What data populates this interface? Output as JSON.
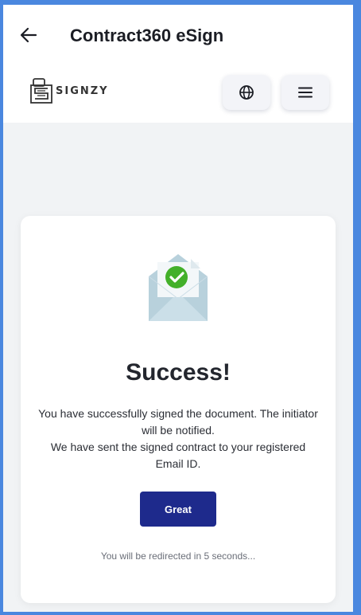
{
  "appbar": {
    "title": "Contract360 eSign"
  },
  "brand": {
    "logo_text": "SIGNZY"
  },
  "success": {
    "heading": "Success!",
    "line1": "You have successfully signed the document. The initiator will be notified.",
    "line2": "We have sent the signed contract to your registered Email ID.",
    "button_label": "Great",
    "redirect_text": "You will be redirected in 5 seconds..."
  },
  "icons": {
    "back": "arrow-left-icon",
    "language": "globe-icon",
    "menu": "hamburger-menu-icon",
    "envelope": "envelope-check-icon"
  },
  "colors": {
    "primary_button": "#1e2a8c",
    "check": "#43b02a",
    "border": "#4a87df"
  }
}
